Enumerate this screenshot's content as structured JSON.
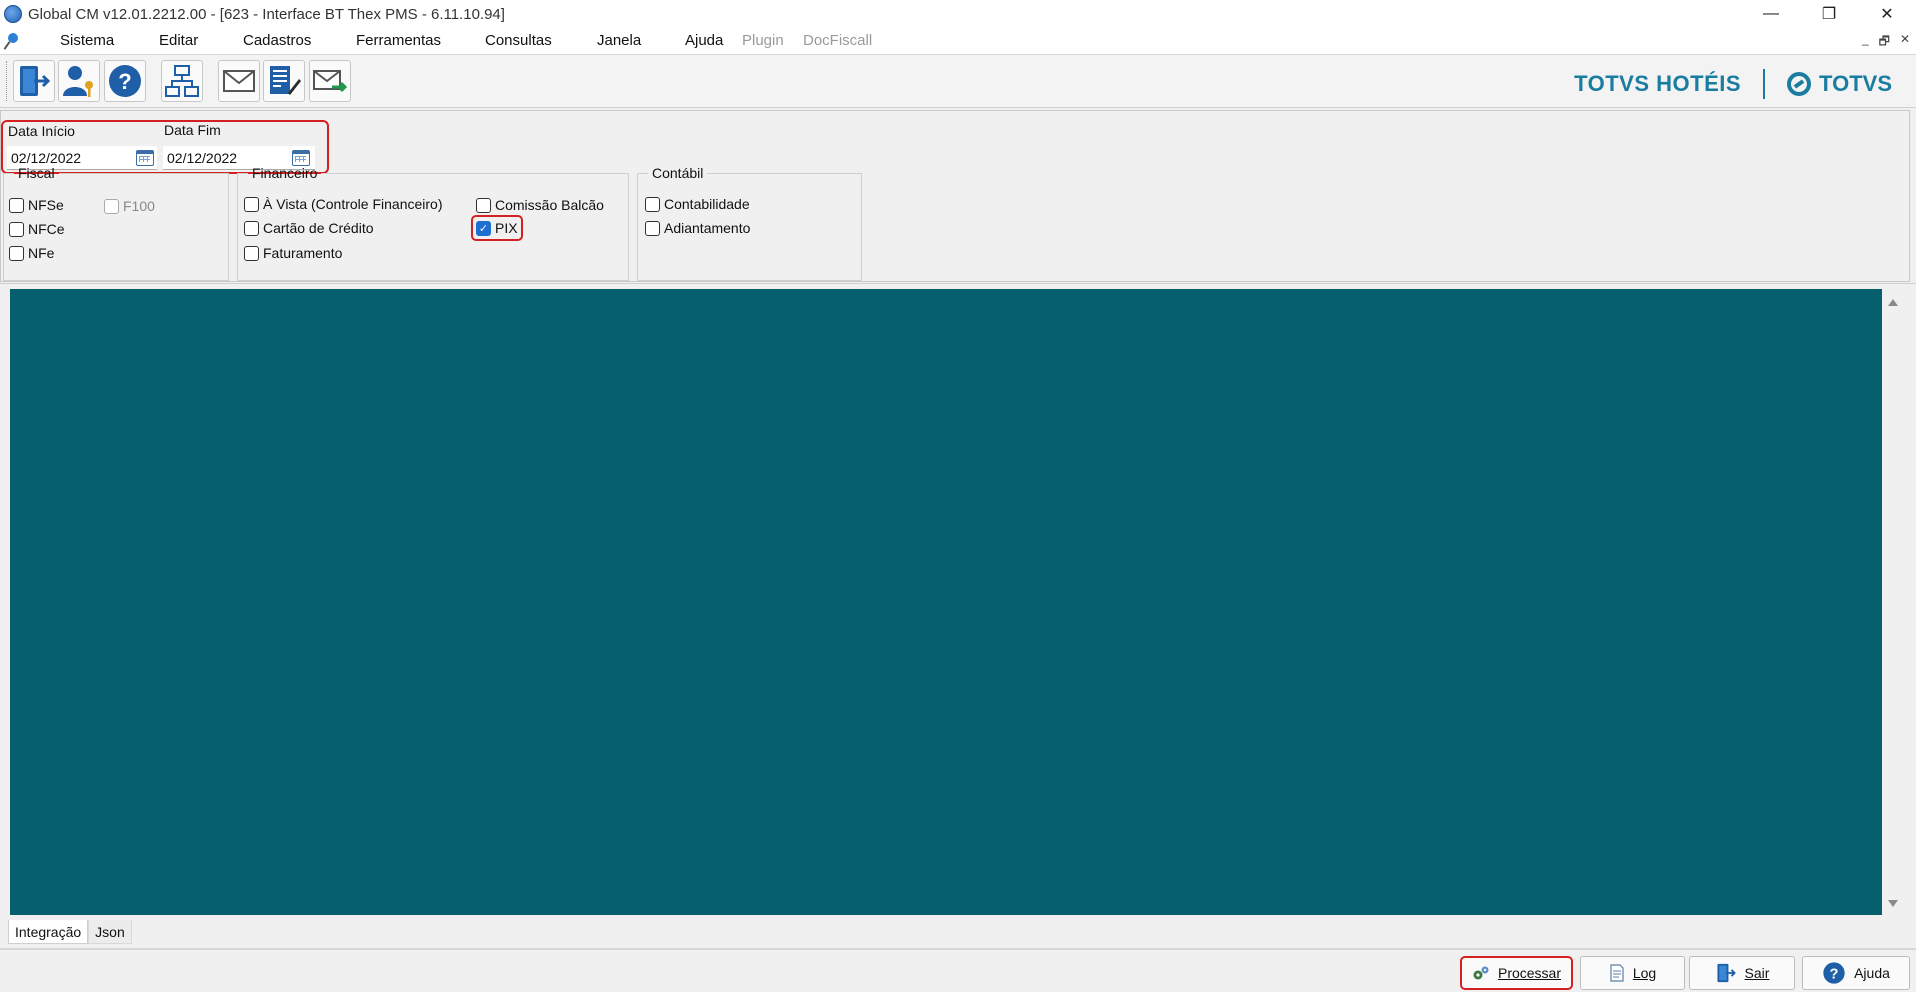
{
  "window": {
    "title": "Global CM v12.01.2212.00 - [623 - Interface BT Thex PMS - 6.11.10.94]",
    "controls": {
      "minimize": "—",
      "restore": "❐",
      "close": "✕"
    }
  },
  "menu": {
    "items": [
      {
        "label": "Sistema"
      },
      {
        "label": "Editar"
      },
      {
        "label": "Cadastros"
      },
      {
        "label": "Ferramentas"
      },
      {
        "label": "Consultas"
      },
      {
        "label": "Janela"
      },
      {
        "label": "Ajuda"
      },
      {
        "label": "Plugin"
      },
      {
        "label": "DocFiscall"
      }
    ],
    "mdi": {
      "minimize": "_",
      "restore": "🗗",
      "close": "✕"
    }
  },
  "toolbar": {
    "icons": [
      "exit-door-icon",
      "user-key-icon",
      "help-icon",
      "org-chart-icon",
      "mail-icon",
      "document-edit-icon",
      "mail-send-icon"
    ]
  },
  "brand": {
    "hoteis": "TOTVS HOTÉIS",
    "totvs": "TOTVS"
  },
  "filters": {
    "data_inicio_label": "Data Início",
    "data_inicio_value": "02/12/2022",
    "data_fim_label": "Data Fim",
    "data_fim_value": "02/12/2022",
    "fiscal": {
      "legend": "Fiscal",
      "nfse": "NFSe",
      "nfce": "NFCe",
      "nfe": "NFe",
      "f100": "F100"
    },
    "financeiro": {
      "legend": "Financeiro",
      "a_vista": "À Vista (Controle Financeiro)",
      "cartao": "Cartão de Crédito",
      "faturamento": "Faturamento",
      "comissao": "Comissão Balcão",
      "pix": "PIX",
      "pix_checked": true
    },
    "contabil": {
      "legend": "Contábil",
      "contabilidade": "Contabilidade",
      "adiantamento": "Adiantamento"
    }
  },
  "content": {
    "background": "#065f6d",
    "tabs": [
      {
        "label": "Integração"
      },
      {
        "label": "Json"
      }
    ]
  },
  "footer": {
    "processar": "Processar",
    "log": "Log",
    "sair": "Sair",
    "ajuda": "Ajuda"
  },
  "colors": {
    "highlight": "#d42020",
    "brand": "#1a7ca0",
    "checked": "#1e6fd0"
  }
}
